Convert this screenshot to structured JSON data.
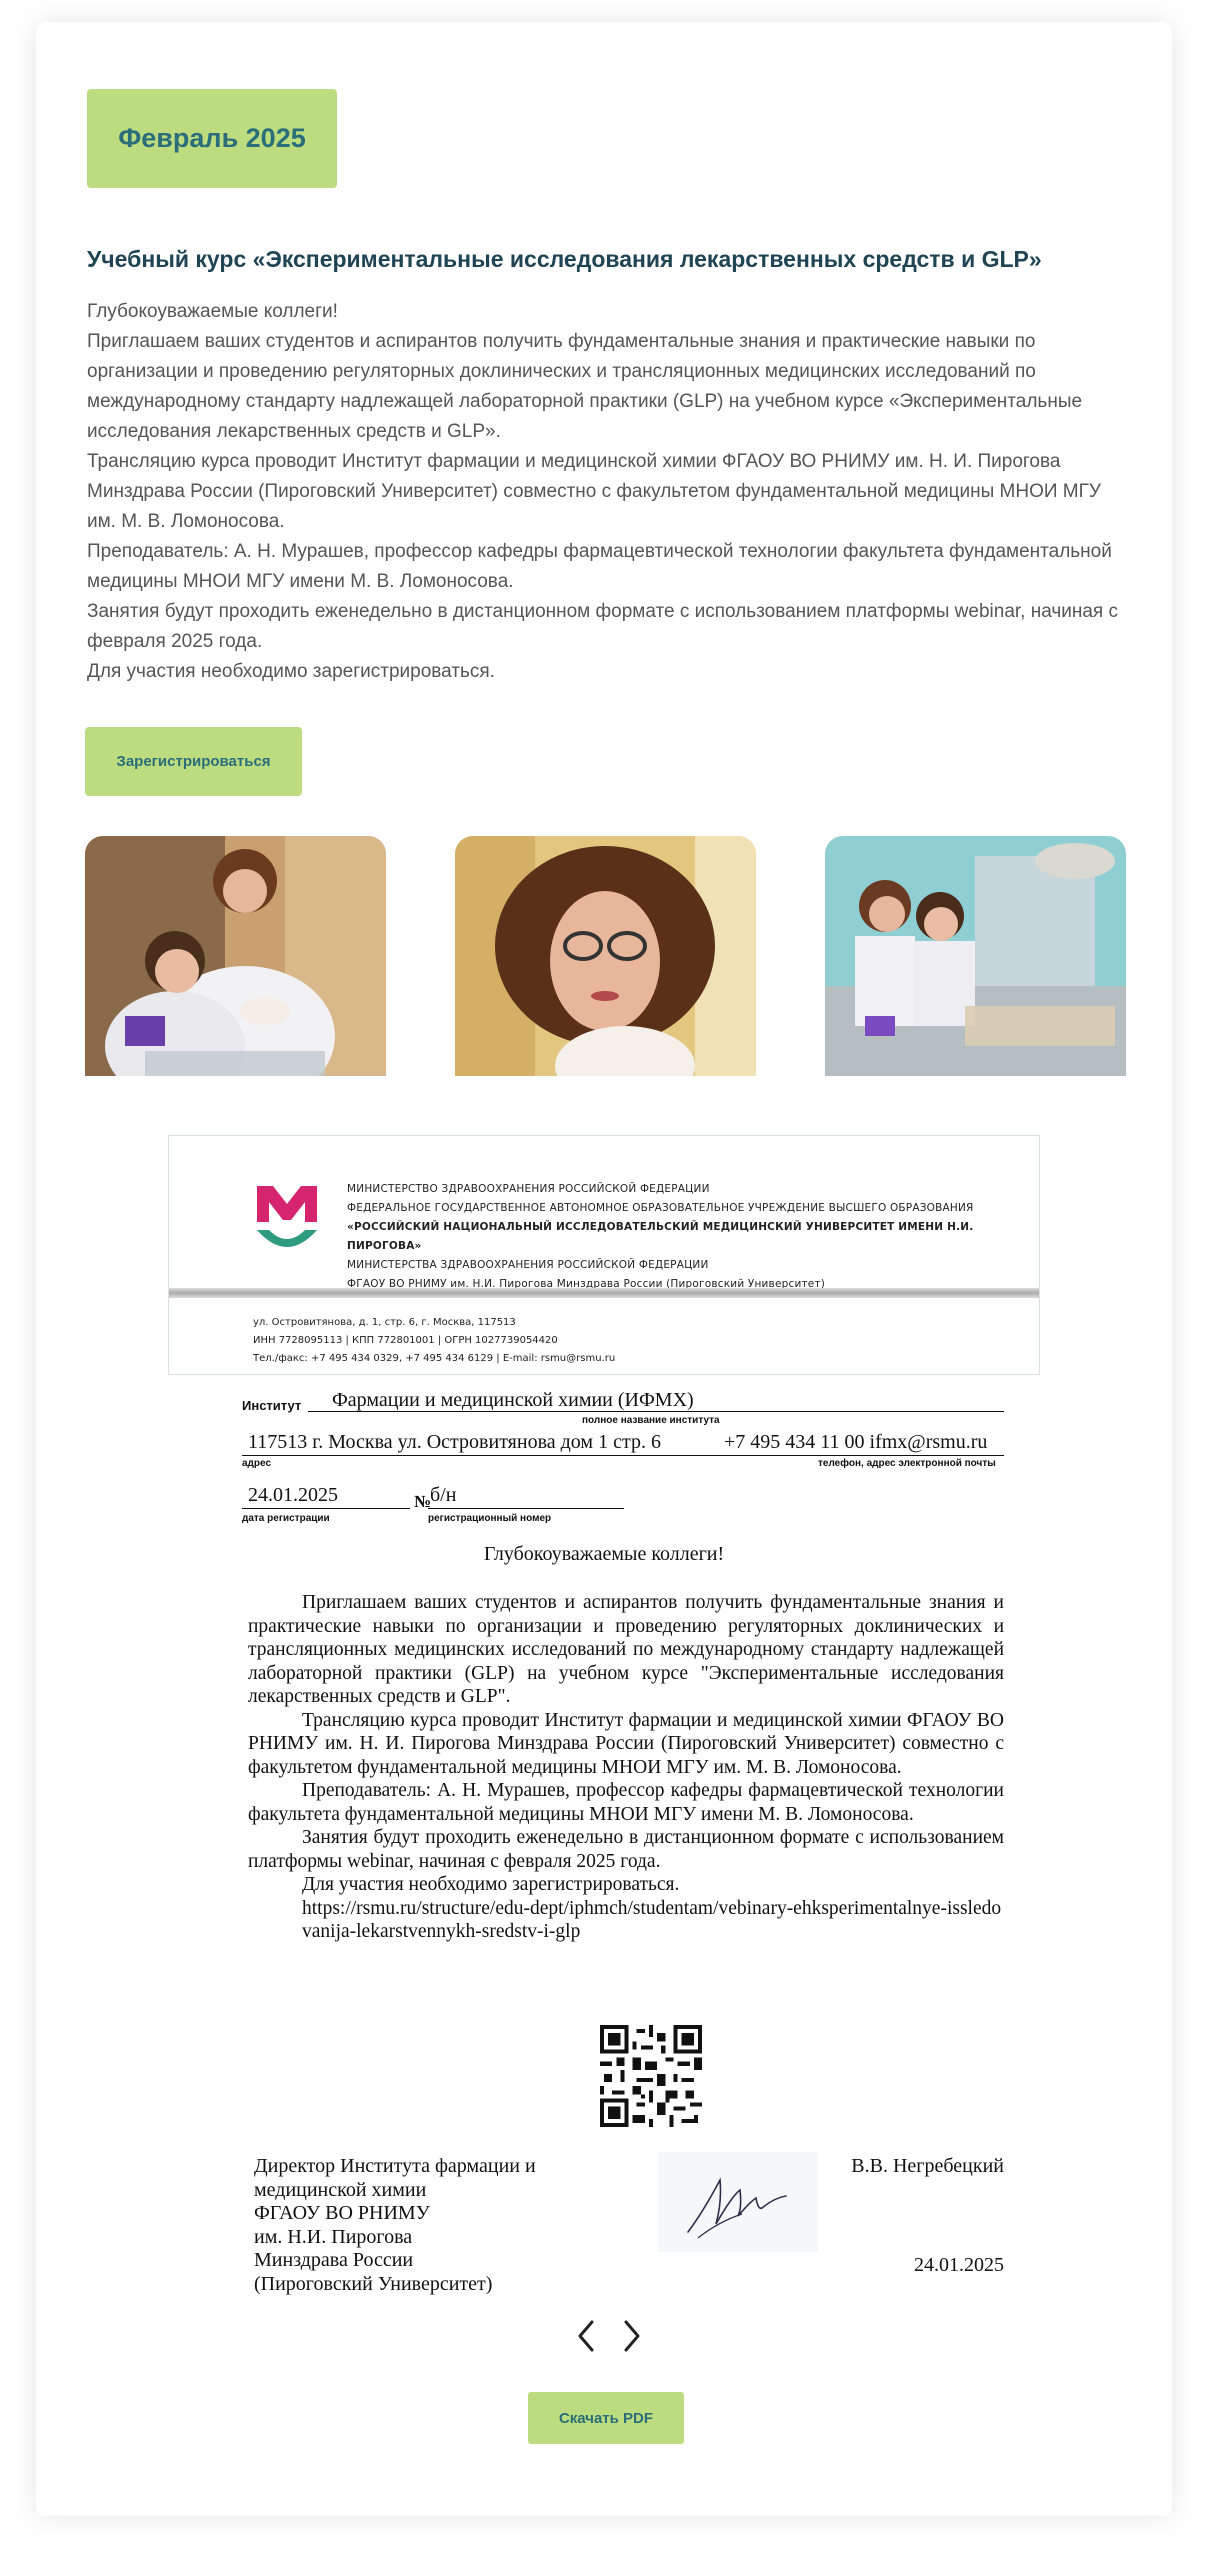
{
  "badge": {
    "label": "Февраль 2025"
  },
  "course": {
    "title": "Учебный курс «Экспериментальные исследования лекарственных средств и GLP»",
    "paragraphs": [
      "Глубокоуважаемые коллеги!",
      "Приглашаем ваших студентов и аспирантов получить фундаментальные знания и практические навыки по организации и проведению регуляторных доклинических и трансляционных медицинских исследований по международному стандарту надлежащей лабораторной практики (GLP) на учебном курсе «Экспериментальные исследования лекарственных средств и GLP».",
      "Трансляцию курса проводит Институт фармации и медицинской химии ФГАОУ ВО РНИМУ им. Н. И. Пирогова Минздрава России (Пироговский Университет) совместно с факультетом фундаментальной медицины МНОИ МГУ им. М. В. Ломоносова.",
      "Преподаватель: А. Н. Мурашев, профессор кафедры фармацевтической технологии факультета фундаментальной медицины МНОИ МГУ имени М. В. Ломоносова.",
      "Занятия будут проходить еженедельно в дистанционном формате с использованием платформы webinar, начиная с февраля 2025 года.",
      "Для участия необходимо зарегистрироваться."
    ]
  },
  "register_button": "Зарегистрироваться",
  "download_button": "Скачать PDF",
  "letterhead": {
    "lines": [
      "МИНИСТЕРСТВО ЗДРАВООХРАНЕНИЯ РОССИЙСКОЙ ФЕДЕРАЦИИ",
      "ФЕДЕРАЛЬНОЕ ГОСУДАРСТВЕННОЕ АВТОНОМНОЕ ОБРАЗОВАТЕЛЬНОЕ УЧРЕЖДЕНИЕ ВЫСШЕГО ОБРАЗОВАНИЯ",
      "«РОССИЙСКИЙ НАЦИОНАЛЬНЫЙ ИССЛЕДОВАТЕЛЬСКИЙ МЕДИЦИНСКИЙ УНИВЕРСИТЕТ ИМЕНИ Н.И. ПИРОГОВА»",
      "МИНИСТЕРСТВА ЗДРАВООХРАНЕНИЯ РОССИЙСКОЙ ФЕДЕРАЦИИ",
      "ФГАОУ ВО РНИМУ им. Н.И. Пирогова Минздрава России (Пироговский Университет)"
    ],
    "address_lines": [
      "ул. Островитянова,  д. 1, стр. 6, г. Москва, 117513",
      "ИНН 7728095113  |  КПП 772801001  |  ОГРН 1027739054420",
      "Тел./факс: +7 495 434 0329, +7 495 434 6129  |  E-mail: rsmu@rsmu.ru"
    ],
    "brand_colors": {
      "pink": "#d6246e",
      "green": "#2e9a7e"
    }
  },
  "letter": {
    "institute_label": "Институт",
    "institute_value": "Фармации и медицинской химии (ИФМХ)",
    "institute_caption": "полное название института",
    "address_value": "117513 г. Москва ул. Островитянова дом 1 стр. 6",
    "phone_value": "+7 495 434 11 00  ifmx@rsmu.ru",
    "address_caption": "адрес",
    "phone_caption": "телефон, адрес электронной почты",
    "reg_date_value": "24.01.2025",
    "reg_num_label": "№",
    "reg_num_value": "б/н",
    "reg_date_caption": "дата регистрации",
    "reg_num_caption": "регистрационный номер",
    "greeting": "Глубокоуважаемые коллеги!",
    "paragraphs": [
      "Приглашаем ваших студентов и аспирантов получить фундаментальные знания и практические навыки по организации и проведению регуляторных доклинических и трансляционных медицинских исследований по международному стандарту надлежащей лабораторной практики (GLP) на учебном курсе \"Экспериментальные исследования лекарственных средств и GLP\".",
      "Трансляцию курса проводит Институт фармации и медицинской химии ФГАОУ ВО РНИМУ им. Н. И. Пирогова Минздрава России (Пироговский Университет) совместно с факультетом фундаментальной медицины МНОИ МГУ им. М. В. Ломоносова.",
      "Преподаватель: А. Н. Мурашев, профессор кафедры фармацевтической технологии факультета фундаментальной медицины МНОИ МГУ имени М. В. Ломоносова.",
      "Занятия будут проходить еженедельно в дистанционном формате с использованием платформы webinar, начиная с февраля 2025 года.",
      "Для участия необходимо зарегистрироваться."
    ],
    "link": "https://rsmu.ru/structure/edu-dept/iphmch/studentam/vebinary-ehksperimentalnye-issledovanija-lekarstvennykh-sredstv-i-glp",
    "signer_position_lines": [
      "Директор Института фармации и",
      "медицинской химии",
      "ФГАОУ ВО РНИМУ",
      "им. Н.И. Пирогова",
      "Минздрава России",
      "(Пироговский Университет)"
    ],
    "signer_name": "В.В. Негребецкий",
    "sign_date": "24.01.2025"
  },
  "colors": {
    "accent_green": "#bcdc7f",
    "accent_teal": "#2a6e7a",
    "title_dark": "#1f4453"
  }
}
